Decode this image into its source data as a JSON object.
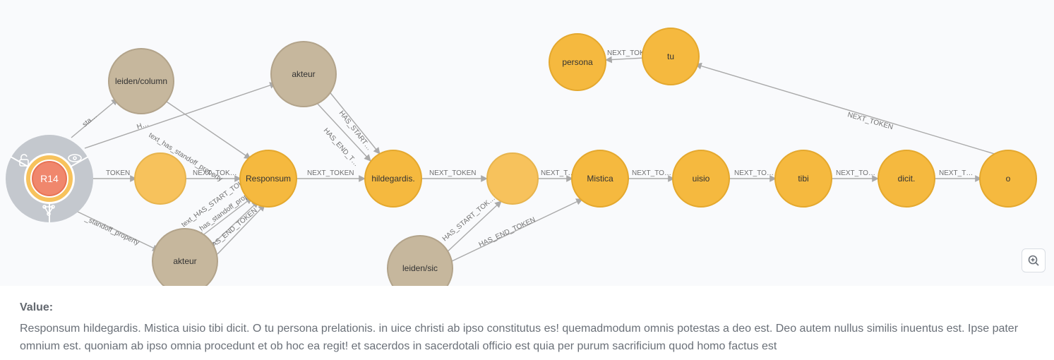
{
  "center_node": {
    "label": "R14"
  },
  "nodes": {
    "leiden_column": {
      "label": "leiden/column",
      "kind": "tan"
    },
    "akteur_top": {
      "label": "akteur",
      "kind": "tan"
    },
    "akteur_bot": {
      "label": "akteur",
      "kind": "tan"
    },
    "leiden_sic": {
      "label": "leiden/sic",
      "kind": "tan"
    },
    "blank1": {
      "label": "",
      "kind": "orange"
    },
    "responsum": {
      "label": "Responsum",
      "kind": "orange"
    },
    "hildegardis": {
      "label": "hildegardis.",
      "kind": "orange"
    },
    "blank2": {
      "label": "",
      "kind": "orange"
    },
    "mistica": {
      "label": "Mistica",
      "kind": "orange"
    },
    "uisio": {
      "label": "uisio",
      "kind": "orange"
    },
    "tibi": {
      "label": "tibi",
      "kind": "orange"
    },
    "dicit": {
      "label": "dicit.",
      "kind": "orange"
    },
    "o": {
      "label": "o",
      "kind": "orange"
    },
    "tu": {
      "label": "tu",
      "kind": "orange"
    },
    "persona": {
      "label": "persona",
      "kind": "orange"
    }
  },
  "edges": {
    "r14_blank1": "TOKEN",
    "blank1_responsum": "NEXT_TOK…",
    "responsum_hilde": "NEXT_TOKEN",
    "hilde_blank2": "NEXT_TOKEN",
    "blank2_mistica": "NEXT_T…",
    "mistica_uisio": "NEXT_TO…",
    "uisio_tibi": "NEXT_TO…",
    "tibi_dicit": "NEXT_TO…",
    "dicit_o": "NEXT_T…",
    "o_tu": "NEXT_TOKEN",
    "tu_persona": "NEXT_TOKEN",
    "r14_leidencol": "sta…",
    "r14_akteurtop": "H…",
    "r14_akteurbot": "_standoff_property",
    "leidencol_resp": "text_has_standoff_property",
    "akteurtop_hilde_s": "HAS_START…",
    "akteurtop_hilde_e": "HAS_END_T…",
    "akteurbot_resp_s": "text_HAS_START_TOK…",
    "akteurbot_resp_so": "text_has_standoff_property",
    "akteurbot_resp_e": "HAS_END_TOKEN",
    "leidensic_blank2": "HAS_START_TOK…",
    "leidensic_mistica": "HAS_END_TOKEN"
  },
  "value_panel": {
    "title": "Value:",
    "text": "Responsum hildegardis.  Mistica uisio tibi dicit. O tu persona prelationis. in uice christi ab ipso constitutus es!  quemadmodum omnis potestas a deo est. Deo autem  nullus similis inuentus est. Ipse pater omnium est.  quoniam ab ipso omnia procedunt et ob hoc ea regit!  et sacerdos in sacerdotali officio est quia per purum sacrificium quod homo factus est"
  },
  "zoom": {
    "tooltip": "Zoom in"
  },
  "chart_data": {
    "type": "graph",
    "note": "Neo4j-style property graph visualization",
    "root": "R14",
    "token_chain": [
      "(blank)",
      "Responsum",
      "hildegardis.",
      "(blank)",
      "Mistica",
      "uisio",
      "tibi",
      "dicit.",
      "o",
      "tu",
      "persona"
    ],
    "standoff_nodes": [
      "leiden/column",
      "akteur",
      "akteur",
      "leiden/sic"
    ],
    "edges": [
      {
        "from": "R14",
        "to": "(blank-1)",
        "label": "TOKEN"
      },
      {
        "from": "(blank-1)",
        "to": "Responsum",
        "label": "NEXT_TOKEN"
      },
      {
        "from": "Responsum",
        "to": "hildegardis.",
        "label": "NEXT_TOKEN"
      },
      {
        "from": "hildegardis.",
        "to": "(blank-2)",
        "label": "NEXT_TOKEN"
      },
      {
        "from": "(blank-2)",
        "to": "Mistica",
        "label": "NEXT_TOKEN"
      },
      {
        "from": "Mistica",
        "to": "uisio",
        "label": "NEXT_TOKEN"
      },
      {
        "from": "uisio",
        "to": "tibi",
        "label": "NEXT_TOKEN"
      },
      {
        "from": "tibi",
        "to": "dicit.",
        "label": "NEXT_TOKEN"
      },
      {
        "from": "dicit.",
        "to": "o",
        "label": "NEXT_TOKEN"
      },
      {
        "from": "o",
        "to": "tu",
        "label": "NEXT_TOKEN"
      },
      {
        "from": "tu",
        "to": "persona",
        "label": "NEXT_TOKEN"
      },
      {
        "from": "R14",
        "to": "leiden/column",
        "label": "standoff_property"
      },
      {
        "from": "R14",
        "to": "akteur-top",
        "label": "H…"
      },
      {
        "from": "R14",
        "to": "akteur-bottom",
        "label": "standoff_property"
      },
      {
        "from": "leiden/column",
        "to": "Responsum",
        "label": "text_has_standoff_property"
      },
      {
        "from": "akteur-top",
        "to": "hildegardis.",
        "label": "HAS_START_TOKEN"
      },
      {
        "from": "akteur-top",
        "to": "hildegardis.",
        "label": "HAS_END_TOKEN"
      },
      {
        "from": "akteur-bottom",
        "to": "Responsum",
        "label": "HAS_START_TOKEN"
      },
      {
        "from": "akteur-bottom",
        "to": "Responsum",
        "label": "text_has_standoff_property"
      },
      {
        "from": "akteur-bottom",
        "to": "Responsum",
        "label": "HAS_END_TOKEN"
      },
      {
        "from": "leiden/sic",
        "to": "(blank-2)",
        "label": "HAS_START_TOKEN"
      },
      {
        "from": "leiden/sic",
        "to": "Mistica",
        "label": "HAS_END_TOKEN"
      }
    ]
  }
}
